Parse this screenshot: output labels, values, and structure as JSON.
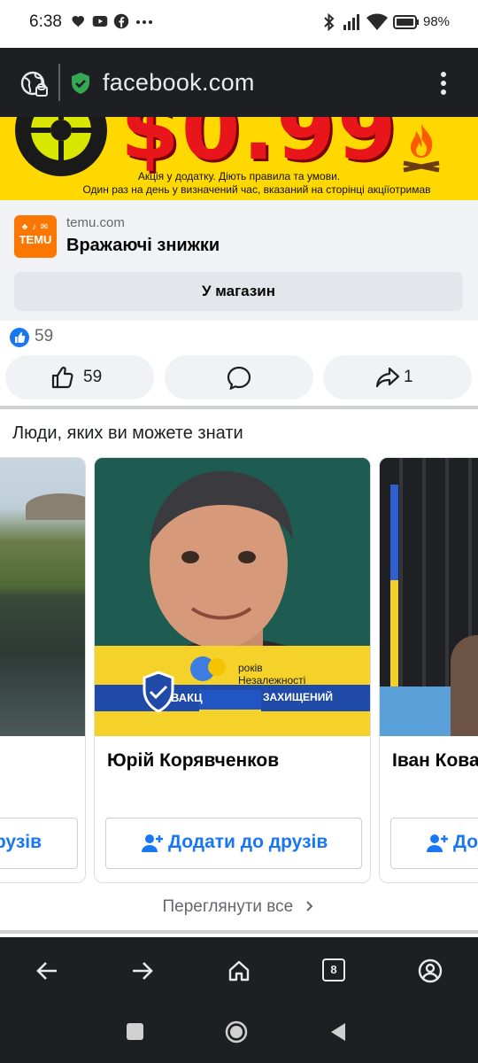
{
  "status_bar": {
    "time": "6:38",
    "battery": "98%",
    "notification_icons": [
      "heart-icon",
      "youtube-icon",
      "facebook-icon",
      "more-dots-icon"
    ],
    "system_icons": [
      "bluetooth-icon",
      "signal-icon",
      "wifi-icon",
      "battery-icon"
    ]
  },
  "browser": {
    "url": "facebook.com",
    "tab_count": "8",
    "toolbar_color": "#1e1f22"
  },
  "ad": {
    "banner_price": "$0.99",
    "banner_line1": "Акція у додатку. Діють правила та умови.",
    "banner_line2": "Один раз на день у визначений час, вказаний на сторінці акціїотримав",
    "logo_text": "TEMU",
    "domain": "temu.com",
    "title": "Вражаючі знижки",
    "cta": "У магазин",
    "brand_color": "#fb7701",
    "banner_color": "#ffd800"
  },
  "post": {
    "reaction_count": "59",
    "like_count": "59",
    "share_count": "1"
  },
  "pymk": {
    "heading": "Люди, яких ви можете знати",
    "cards": [
      {
        "name": "",
        "button": "рузів"
      },
      {
        "name": "Юрій Корявченков",
        "button": "Додати до друзів",
        "photo_text_1": "років",
        "photo_text_2": "Незалежності",
        "photo_badge_left": "ВАКЦ",
        "photo_badge_right": "ЗАХИЩЕНИЙ"
      },
      {
        "name": "Іван Кова",
        "button": "Дод"
      }
    ],
    "see_all": "Переглянути все"
  },
  "colors": {
    "accent": "#1877f2",
    "muted": "#65676b"
  }
}
